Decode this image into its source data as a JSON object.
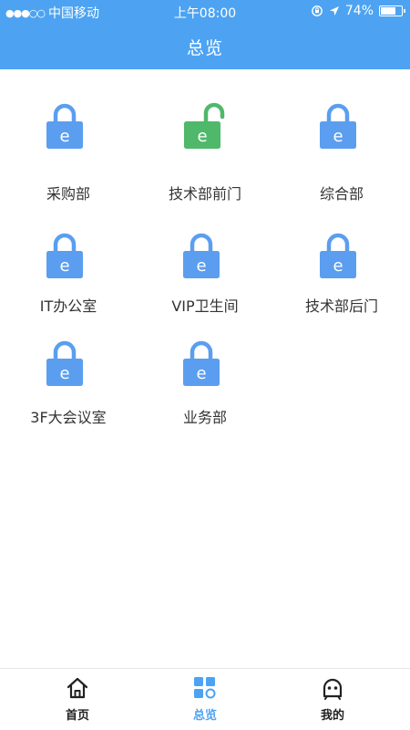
{
  "status_bar": {
    "signal": "●●●○○",
    "carrier": "中国移动",
    "time": "上午08:00",
    "battery": "74%",
    "battery_level": 0.74
  },
  "header": {
    "title": "总览"
  },
  "doors": [
    {
      "name": "采购部",
      "locked": true,
      "icon": "lock-closed-icon"
    },
    {
      "name": "技术部前门",
      "locked": false,
      "icon": "lock-open-icon"
    },
    {
      "name": "综合部",
      "locked": true,
      "icon": "lock-closed-icon"
    },
    {
      "name": "IT办公室",
      "locked": true,
      "icon": "lock-closed-icon"
    },
    {
      "name": "VIP卫生间",
      "locked": true,
      "icon": "lock-closed-icon"
    },
    {
      "name": "技术部后门",
      "locked": true,
      "icon": "lock-closed-icon"
    },
    {
      "name": "3F大会议室",
      "locked": true,
      "icon": "lock-closed-icon"
    },
    {
      "name": "业务部",
      "locked": true,
      "icon": "lock-closed-icon"
    }
  ],
  "lock_glyph": "e",
  "tabs": [
    {
      "label": "首页",
      "icon": "home-icon"
    },
    {
      "label": "总览",
      "icon": "grid-icon",
      "active": true
    },
    {
      "label": "我的",
      "icon": "user-face-icon"
    }
  ],
  "colors": {
    "accent": "#4da3f2",
    "locked": "#5b9ef0",
    "unlocked": "#4fb86a"
  }
}
